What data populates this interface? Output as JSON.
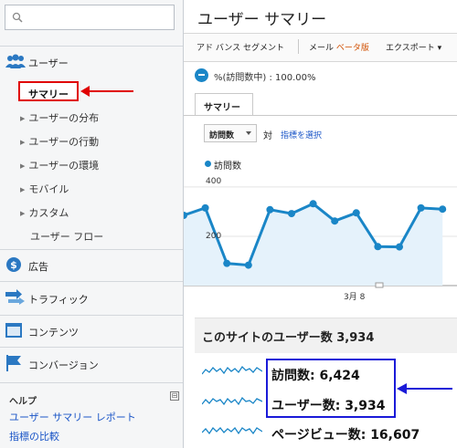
{
  "sidebar": {
    "search": {
      "placeholder": ""
    },
    "users": {
      "label": "ユーザー"
    },
    "summary": {
      "label": "サマリー"
    },
    "sub_items": [
      "ユーザーの分布",
      "ユーザーの行動",
      "ユーザーの環境",
      "モバイル",
      "カスタム"
    ],
    "user_flow": "ユーザー フロー",
    "ads": "広告",
    "traffic": "トラフィック",
    "content": "コンテンツ",
    "conversion": "コンバージョン",
    "help": {
      "title": "ヘルプ",
      "toggle": "⊟",
      "links": [
        "ユーザー サマリー レポート",
        "指標の比較"
      ]
    }
  },
  "main": {
    "title": "ユーザー サマリー",
    "toolbar": {
      "advanced_segment": "アド バンス セグメント",
      "mail": "メール",
      "beta": "ベータ版",
      "export": "エクスポート"
    },
    "segment": "%(訪問数中) : 100.00%",
    "tab": "サマリー",
    "metric_dropdown": "訪問数",
    "vs": "対",
    "select_metric": "指標を選択",
    "legend": "訪問数",
    "y_ticks": [
      "400",
      "200"
    ],
    "x_tick": "3月 8",
    "section_title": "このサイトのユーザー数 3,934",
    "stats": [
      "訪問数: 6,424",
      "ユーザー数: 3,934",
      "ページビュー数: 16,607"
    ]
  },
  "colors": {
    "accent": "#1a86c7",
    "highlight_red": "#e00000",
    "highlight_blue": "#1a1ad8"
  },
  "chart_data": {
    "type": "area",
    "series": [
      {
        "name": "訪問数",
        "values": [
          285,
          315,
          90,
          83,
          308,
          292,
          332,
          262,
          295,
          158,
          157,
          315,
          310
        ]
      }
    ],
    "ylim": [
      0,
      470
    ],
    "y_ticks": [
      200,
      400
    ],
    "x_tick_label": "3月 8",
    "grid": true
  }
}
